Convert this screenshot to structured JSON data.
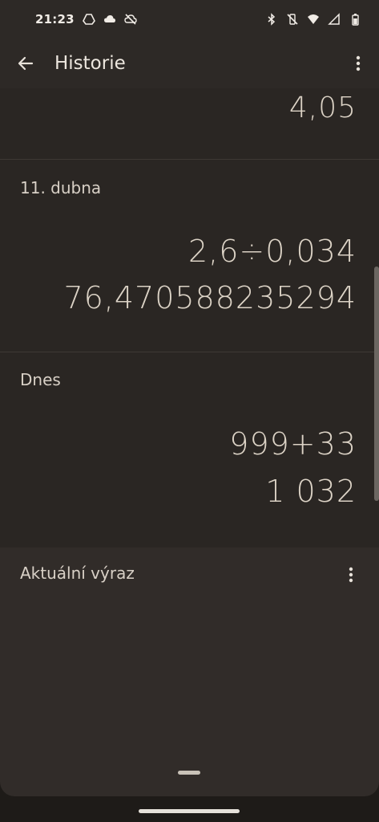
{
  "status_bar": {
    "time": "21:23",
    "left_icons": [
      "drive-icon",
      "cloud-icon",
      "cloud-off-icon"
    ],
    "right_icons": [
      "bluetooth-icon",
      "vibrate-off-icon",
      "wifi-icon",
      "signal-icon",
      "battery-icon"
    ]
  },
  "app_bar": {
    "title": "Historie"
  },
  "history": {
    "previous_result": "4,05",
    "groups": [
      {
        "date": "11. dubna",
        "expression": "2,6÷0,034",
        "result": "76,470588235294"
      },
      {
        "date": "Dnes",
        "expression": "999+33",
        "result": "1 032"
      }
    ]
  },
  "current": {
    "label": "Aktuální výraz"
  },
  "colors": {
    "background": "#1e1b18",
    "surface": "#2a2623",
    "panel": "#312c29",
    "text": "#dcd3c6"
  }
}
